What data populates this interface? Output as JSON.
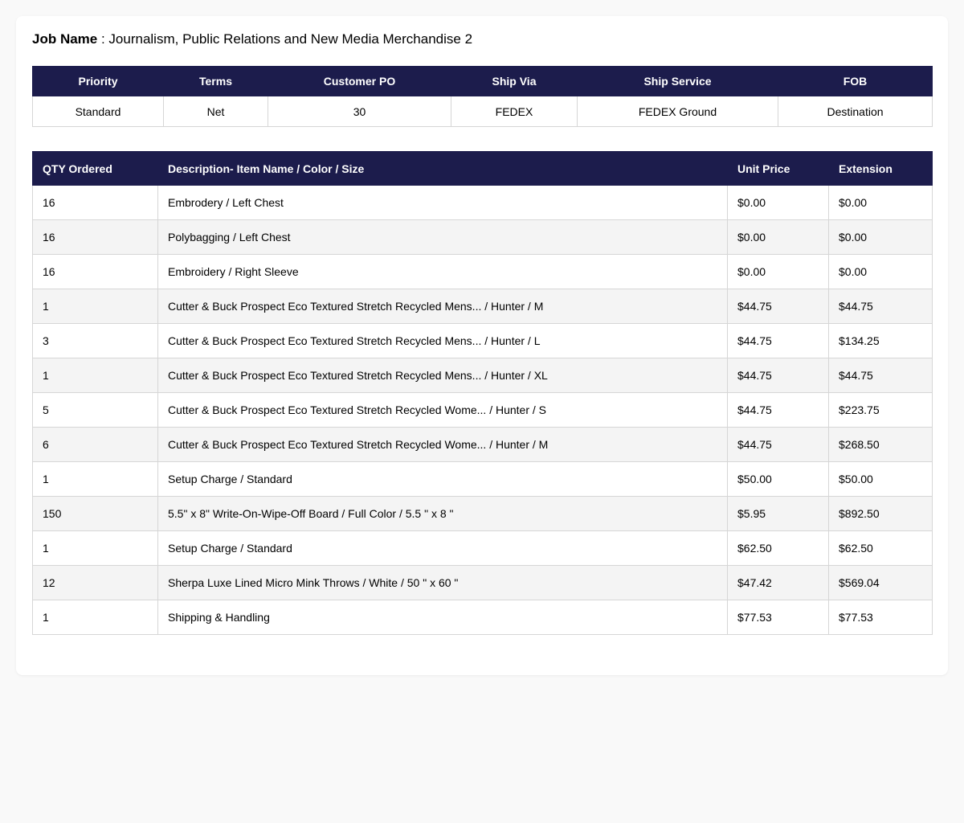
{
  "job": {
    "label": "Job Name",
    "separator": " : ",
    "value": "Journalism, Public Relations and New Media Merchandise 2"
  },
  "order_info": {
    "headers": [
      "Priority",
      "Terms",
      "Customer PO",
      "Ship Via",
      "Ship Service",
      "FOB"
    ],
    "values": [
      "Standard",
      "Net",
      "30",
      "FEDEX",
      "FEDEX Ground",
      "Destination"
    ]
  },
  "items": {
    "headers": [
      "QTY Ordered",
      "Description- Item Name / Color / Size",
      "Unit Price",
      "Extension"
    ],
    "rows": [
      {
        "qty": "16",
        "desc": "Embrodery / Left Chest",
        "unit": "$0.00",
        "ext": "$0.00"
      },
      {
        "qty": "16",
        "desc": "Polybagging / Left Chest",
        "unit": "$0.00",
        "ext": "$0.00"
      },
      {
        "qty": "16",
        "desc": "Embroidery / Right Sleeve",
        "unit": "$0.00",
        "ext": "$0.00"
      },
      {
        "qty": "1",
        "desc": "Cutter & Buck Prospect Eco Textured Stretch Recycled Mens... / Hunter / M",
        "unit": "$44.75",
        "ext": "$44.75"
      },
      {
        "qty": "3",
        "desc": "Cutter & Buck Prospect Eco Textured Stretch Recycled Mens... / Hunter / L",
        "unit": "$44.75",
        "ext": "$134.25"
      },
      {
        "qty": "1",
        "desc": "Cutter & Buck Prospect Eco Textured Stretch Recycled Mens... / Hunter / XL",
        "unit": "$44.75",
        "ext": "$44.75"
      },
      {
        "qty": "5",
        "desc": "Cutter & Buck Prospect Eco Textured Stretch Recycled Wome... / Hunter / S",
        "unit": "$44.75",
        "ext": "$223.75"
      },
      {
        "qty": "6",
        "desc": "Cutter & Buck Prospect Eco Textured Stretch Recycled Wome... / Hunter / M",
        "unit": "$44.75",
        "ext": "$268.50"
      },
      {
        "qty": "1",
        "desc": "Setup Charge / Standard",
        "unit": "$50.00",
        "ext": "$50.00"
      },
      {
        "qty": "150",
        "desc": "5.5\" x 8\" Write-On-Wipe-Off Board / Full Color / 5.5 \" x 8 \"",
        "unit": "$5.95",
        "ext": "$892.50"
      },
      {
        "qty": "1",
        "desc": "Setup Charge / Standard",
        "unit": "$62.50",
        "ext": "$62.50"
      },
      {
        "qty": "12",
        "desc": "Sherpa Luxe Lined Micro Mink Throws / White / 50 \" x 60 \"",
        "unit": "$47.42",
        "ext": "$569.04"
      },
      {
        "qty": "1",
        "desc": "Shipping & Handling",
        "unit": "$77.53",
        "ext": "$77.53"
      }
    ]
  },
  "colors": {
    "header_bg": "#1c1c4c",
    "page_bg": "#f9f9f9",
    "stripe": "#f4f4f4"
  }
}
